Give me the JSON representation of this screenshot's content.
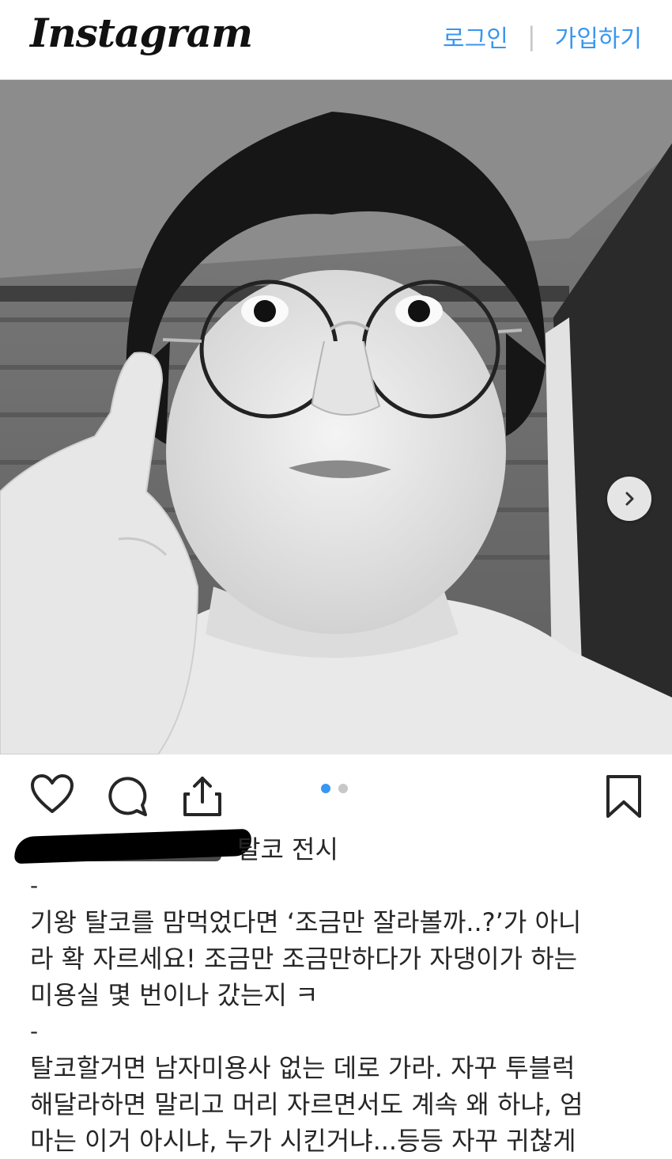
{
  "header": {
    "logo": "Instagram",
    "login": "로그인",
    "separator": "|",
    "signup": "가입하기"
  },
  "post": {
    "image_alt": "selfie-photo",
    "carousel": {
      "count": 2,
      "active_index": 0
    },
    "caption_author_tail": "탈코 전시",
    "separator_1": "-",
    "paragraph_1": [
      "기왕 탈코를 맘먹었다면 ‘조금만 잘라볼까..?’가 아니",
      "라 확 자르세요! 조금만 조금만하다가 자댕이가 하는",
      "미용실 몇 번이나 갔는지 ㅋ"
    ],
    "separator_2": "-",
    "paragraph_2": [
      "탈코할거면 남자미용사 없는 데로 가라. 자꾸 투블럭",
      "해달라하면 말리고 머리 자르면서도 계속 왜 하냐, 엄",
      "마는 이거 아시냐, 누가 시킨거냐...등등 자꾸 귀찮게"
    ]
  },
  "icons": {
    "like": "heart-icon",
    "comment": "comment-icon",
    "share": "share-icon",
    "save": "bookmark-icon",
    "next": "chevron-right-icon"
  },
  "colors": {
    "accent": "#3897f0",
    "dot_inactive": "#c7c7c7",
    "text": "#262626"
  }
}
